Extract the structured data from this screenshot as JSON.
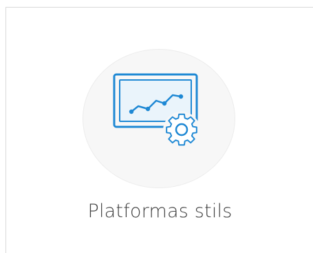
{
  "card": {
    "label": "Platformas stils",
    "icon": "chart-monitor-gear-icon",
    "accent_color": "#1e88d4",
    "circle_color": "#f7f7f7"
  }
}
